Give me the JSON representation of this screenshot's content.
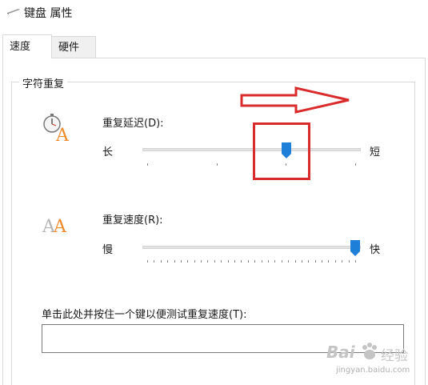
{
  "window": {
    "title": "键盘 属性",
    "icon": "keyboard-icon"
  },
  "tabs": [
    {
      "label": "速度",
      "active": true
    },
    {
      "label": "硬件",
      "active": false
    }
  ],
  "repeat_group": {
    "title": "字符重复",
    "delay": {
      "label": "重复延迟(D):",
      "min_label": "长",
      "max_label": "短",
      "value_fraction": 0.67,
      "icon": "stopwatch-letter-a-icon"
    },
    "rate": {
      "label": "重复速度(R):",
      "min_label": "慢",
      "max_label": "快",
      "value_fraction": 1.0,
      "icon": "double-letter-a-icon"
    },
    "test": {
      "label": "单击此处并按住一个键以便测试重复速度(T):",
      "value": ""
    }
  },
  "watermark": {
    "brand": "Bai",
    "brand2": "经验",
    "url": "jingyan.baidu.com"
  },
  "colors": {
    "thumb": "#1e7fd8",
    "annotation": "#d92b2b"
  }
}
